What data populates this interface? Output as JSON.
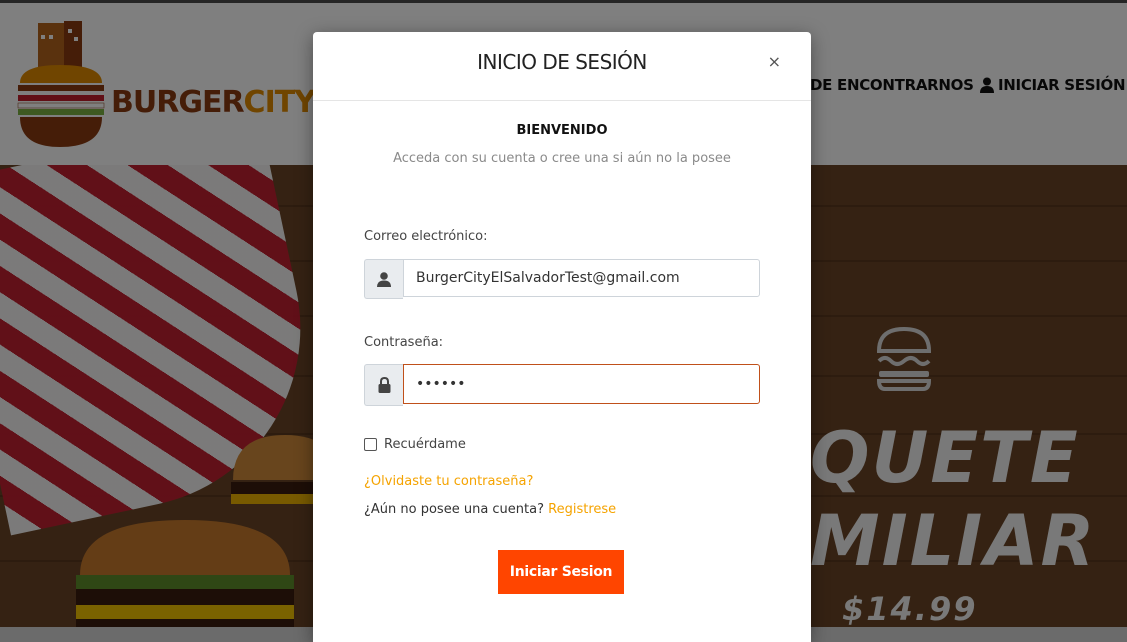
{
  "brand": {
    "name_part1": "BURGER",
    "name_part2": "CITY"
  },
  "nav": {
    "find_us": "DE ENCONTRARNOS",
    "login": "INICIAR SESIÓN"
  },
  "promo": {
    "line1": "QUETE",
    "line2": "MILIAR",
    "price": "$14.99"
  },
  "modal": {
    "title": "INICIO DE SESIÓN",
    "close": "×",
    "welcome": "BIENVENIDO",
    "subtitle": "Acceda con su cuenta o cree una si aún no la posee",
    "email_label": "Correo electrónico:",
    "email_value": "BurgerCityElSalvadorTest@gmail.com",
    "password_label": "Contraseña:",
    "password_value": "••••••",
    "remember_label": "Recuérdame",
    "forgot_link": "¿Olvidaste tu contraseña?",
    "no_account_text": "¿Aún no posee una cuenta? ",
    "register_link": "Registrese",
    "submit_label": "Iniciar Sesion"
  },
  "colors": {
    "accent": "#ff4500",
    "link": "#f5a300",
    "focus_border": "#c0501a"
  }
}
